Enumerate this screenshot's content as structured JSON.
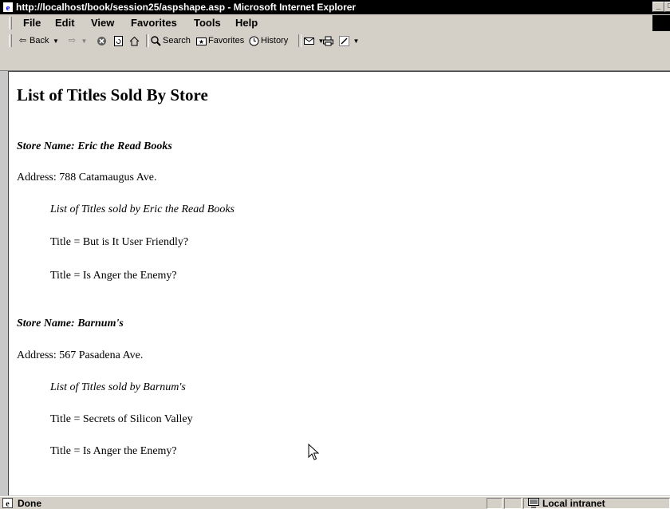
{
  "window": {
    "title": "http://localhost/book/session25/aspshape.asp - Microsoft Internet Explorer"
  },
  "menubar": {
    "items": [
      "File",
      "Edit",
      "View",
      "Favorites",
      "Tools",
      "Help"
    ]
  },
  "toolbar": {
    "back_label": "Back",
    "search_label": "Search",
    "favorites_label": "Favorites",
    "history_label": "History"
  },
  "page": {
    "heading": "List of Titles Sold By Store",
    "stores": [
      {
        "name": "Store Name: Eric the Read Books",
        "address": "Address: 788 Catamaugus Ave.",
        "list_label": "List of Titles sold by Eric the Read Books",
        "titles": [
          "Title = But is It User Friendly?",
          "Title = Is Anger the Enemy?"
        ]
      },
      {
        "name": "Store Name: Barnum's",
        "address": "Address: 567 Pasadena Ave.",
        "list_label": "List of Titles sold by Barnum's",
        "titles": [
          "Title = Secrets of Silicon Valley",
          "Title = Is Anger the Enemy?"
        ]
      }
    ]
  },
  "statusbar": {
    "status": "Done",
    "zone": "Local intranet"
  }
}
